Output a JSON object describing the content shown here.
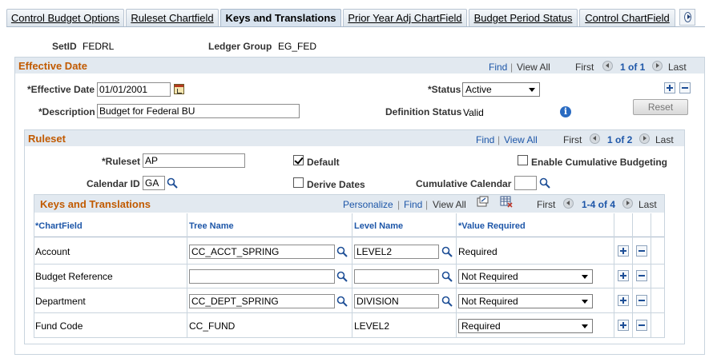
{
  "tabs": [
    {
      "label": "Control Budget Options"
    },
    {
      "label": "Ruleset Chartfield"
    },
    {
      "label": "Keys and Translations"
    },
    {
      "label": "Prior Year Adj ChartField"
    },
    {
      "label": "Budget Period Status"
    },
    {
      "label": "Control ChartField"
    }
  ],
  "header": {
    "setid_label": "SetID",
    "setid_value": "FEDRL",
    "ledger_group_label": "Ledger Group",
    "ledger_group_value": "EG_FED"
  },
  "effective": {
    "title": "Effective Date",
    "find": "Find",
    "view_all": "View All",
    "sep": "|",
    "first": "First",
    "count": "1 of 1",
    "last": "Last",
    "eff_date_label": "*Effective Date",
    "eff_date_value": "01/01/2001",
    "status_label": "*Status",
    "status_value": "Active",
    "description_label": "*Description",
    "description_value": "Budget for Federal BU",
    "def_status_label": "Definition Status",
    "def_status_value": "Valid",
    "reset_label": "Reset"
  },
  "ruleset": {
    "title": "Ruleset",
    "find": "Find",
    "view_all": "View All",
    "sep": "|",
    "first": "First",
    "count": "1 of 2",
    "last": "Last",
    "ruleset_label": "*Ruleset",
    "ruleset_value": "AP",
    "default_label": "Default",
    "default_checked": true,
    "enable_cum_label": "Enable Cumulative Budgeting",
    "enable_cum_checked": false,
    "calendar_id_label": "Calendar ID",
    "calendar_id_value": "GA",
    "derive_dates_label": "Derive Dates",
    "derive_dates_checked": false,
    "cum_calendar_label": "Cumulative Calendar",
    "cum_calendar_value": ""
  },
  "keys": {
    "title": "Keys and Translations",
    "personalize": "Personalize",
    "find": "Find",
    "view_all": "View All",
    "sep": "|",
    "first": "First",
    "count": "1-4 of 4",
    "last": "Last",
    "columns": {
      "chartfield": "*ChartField",
      "tree_name": "Tree Name",
      "level_name": "Level Name",
      "value_required": "*Value Required"
    },
    "rows": [
      {
        "chartfield": "Account",
        "tree_name": "CC_ACCT_SPRING",
        "level_name": "LEVEL2",
        "value_required": "Required",
        "editable": true,
        "select": false
      },
      {
        "chartfield": "Budget Reference",
        "tree_name": "",
        "level_name": "",
        "value_required": "Not Required",
        "editable": true,
        "select": true
      },
      {
        "chartfield": "Department",
        "tree_name": "CC_DEPT_SPRING",
        "level_name": "DIVISION",
        "value_required": "Not Required",
        "editable": true,
        "select": true
      },
      {
        "chartfield": "Fund Code",
        "tree_name": "CC_FUND",
        "level_name": "LEVEL2",
        "value_required": "Required",
        "editable": false,
        "select": true
      }
    ]
  },
  "colors": {
    "section_title": "#c15a00",
    "link": "#1d56a8",
    "header_bg": "#e2e9f0"
  }
}
